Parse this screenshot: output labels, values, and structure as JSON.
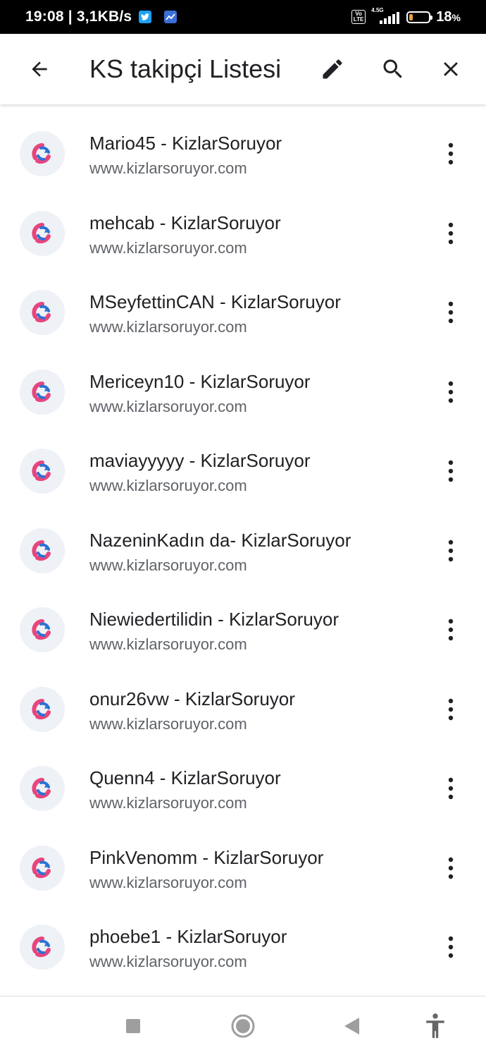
{
  "status_bar": {
    "time_speed": "19:08 | 3,1KB/s",
    "network_type": "4.5G",
    "volte": "Vo LTE",
    "battery_level": 0.18,
    "battery_percent": "18",
    "battery_percent_sign": "%",
    "battery_color": "#e8a33c",
    "notification_icons": [
      "twitter-icon",
      "stats-chart-icon"
    ]
  },
  "app_bar": {
    "title": "KS takipçi Listesi",
    "icons": [
      "back-arrow-icon",
      "edit-pencil-icon",
      "search-icon",
      "close-icon"
    ]
  },
  "list": {
    "items": [
      {
        "title": "Mario45 - KizlarSoruyor",
        "url": "www.kizlarsoruyor.com"
      },
      {
        "title": "mehcab - KizlarSoruyor",
        "url": "www.kizlarsoruyor.com"
      },
      {
        "title": "MSeyfettinCAN - KizlarSoruyor",
        "url": "www.kizlarsoruyor.com"
      },
      {
        "title": "Mericeyn10 - KizlarSoruyor",
        "url": "www.kizlarsoruyor.com"
      },
      {
        "title": "maviayyyyy - KizlarSoruyor",
        "url": "www.kizlarsoruyor.com"
      },
      {
        "title": "NazeninKadın da- KizlarSoruyor",
        "url": "www.kizlarsoruyor.com"
      },
      {
        "title": "Niewiedertilidin - KizlarSoruyor",
        "url": "www.kizlarsoruyor.com"
      },
      {
        "title": "onur26vw - KizlarSoruyor",
        "url": "www.kizlarsoruyor.com"
      },
      {
        "title": "Quenn4 - KizlarSoruyor",
        "url": "www.kizlarsoruyor.com"
      },
      {
        "title": "PinkVenomm - KizlarSoruyor",
        "url": "www.kizlarsoruyor.com"
      },
      {
        "title": "phoebe1 - KizlarSoruyor",
        "url": "www.kizlarsoruyor.com"
      }
    ],
    "favicon_colors": {
      "pink": "#e8457c",
      "blue": "#2a72d6"
    }
  },
  "nav_bar": {
    "icons": [
      "recents-square-icon",
      "home-circle-icon",
      "back-triangle-icon",
      "accessibility-icon"
    ],
    "color": "#9e9e9e"
  }
}
